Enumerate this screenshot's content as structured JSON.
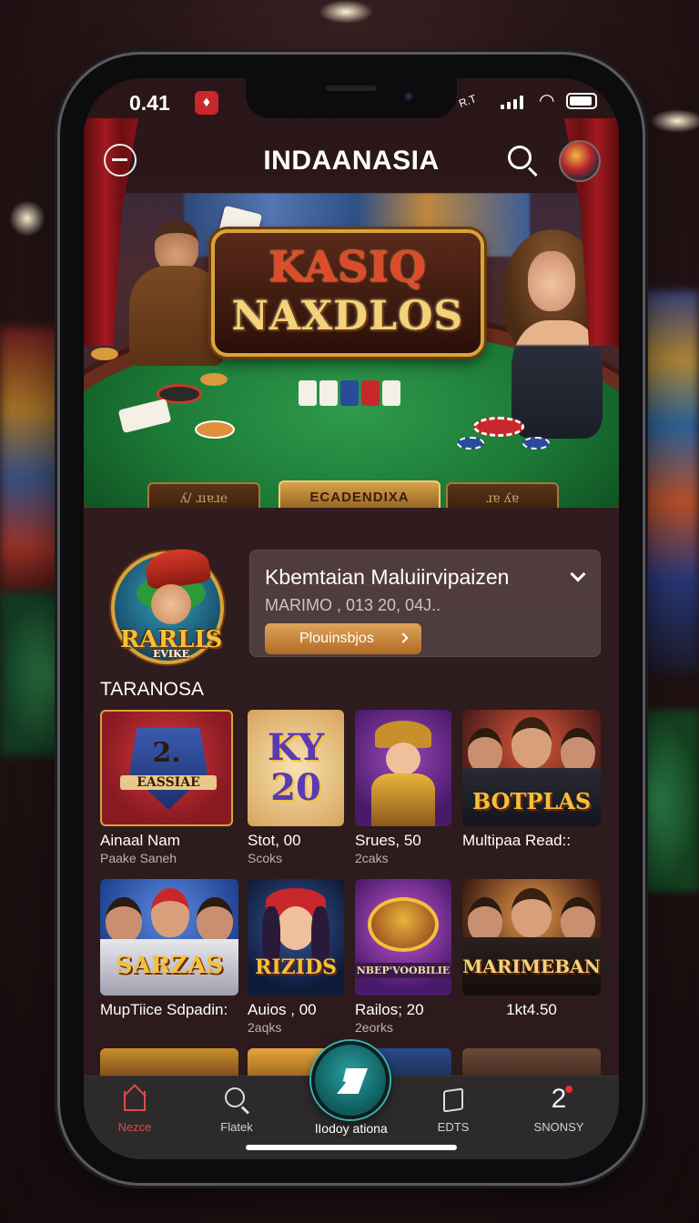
{
  "status_bar": {
    "time": "0.41",
    "app_icon": "flame-icon",
    "network": "R.T"
  },
  "header": {
    "title": "INDAANASIA",
    "menu_icon": "minus-circle-icon",
    "search_icon": "search-icon",
    "avatar_icon": "chips-avatar-icon"
  },
  "hero": {
    "logo_line1": "KASIQ",
    "logo_line2": "NAXDLOS",
    "plaque_center": "ECADENDIXA",
    "plaque_left": "ʎ/ ɹıɐɹe",
    "plaque_right": "ɹɐ ʎɐ"
  },
  "featured": {
    "logo_text": "RARLIS",
    "logo_subtext": "EVIKE",
    "title": "Kbemtaian Maluiirvipaizen",
    "meta": "MARIMO , 013 20, 04J..",
    "button_label": "Plouinsbjos"
  },
  "section": {
    "title": "TARANOSA"
  },
  "games": [
    {
      "name": "Ainaal Nam",
      "sub": "Paake Saneh",
      "art_label": "2.",
      "art_sub": "EASSIAE",
      "bg": "#a4222a"
    },
    {
      "name": "Stot, 00",
      "sub": "Scoks",
      "art_label": "KY",
      "art_sub": "20",
      "bg": "#e8c88a"
    },
    {
      "name": "Srues, 50",
      "sub": "2caks",
      "art_label": "",
      "art_sub": "",
      "bg": "#6a2a8a"
    },
    {
      "name": "Multipaa Read::",
      "sub": "",
      "art_label": "BOTPLAS",
      "art_sub": "",
      "bg": "#4a2a2a"
    },
    {
      "name": "MupTiice Sdpadin:",
      "sub": "",
      "art_label": "SARZAS",
      "art_sub": "",
      "bg": "#2a4a9a"
    },
    {
      "name": "Auios , 00",
      "sub": "2aqks",
      "art_label": "RIZIDS",
      "art_sub": "",
      "bg": "#1a2a4a"
    },
    {
      "name": "Railos; 20",
      "sub": "2eorks",
      "art_label": "NBEP'VOOBILIE",
      "art_sub": "",
      "bg": "#7a2a8a"
    },
    {
      "name": "1kt4.50",
      "sub": "",
      "art_label": "MARIMEBAN",
      "art_sub": "",
      "bg": "#3a2418"
    }
  ],
  "bottom_nav": {
    "items": [
      {
        "label": "Nezce",
        "icon": "home-icon"
      },
      {
        "label": "Flatek",
        "icon": "search-icon"
      },
      {
        "label": "EDTS",
        "icon": "box-icon"
      },
      {
        "label": "SNONSY",
        "icon": "notification-two-icon"
      }
    ],
    "fab_label": "lIodoy ationa",
    "fab_icon": "arrow-icon"
  },
  "colors": {
    "accent": "#e04a4a",
    "gold": "#d8a43a",
    "fab": "#1e8a8c"
  }
}
